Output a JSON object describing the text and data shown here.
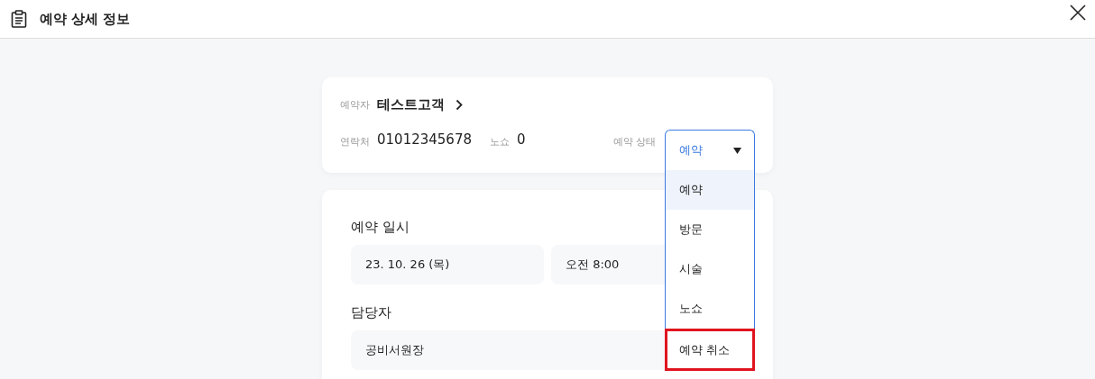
{
  "header": {
    "title": "예약 상세 정보"
  },
  "customer": {
    "label": "예약자",
    "name": "테스트고객",
    "contact_label": "연락처",
    "contact": "01012345678",
    "no_show_label": "노쇼",
    "no_show": "0",
    "status_label": "예약 상태",
    "status": {
      "value": "예약",
      "expanded": true,
      "options": [
        {
          "label": "예약",
          "selected": true,
          "highlighted": false
        },
        {
          "label": "방문",
          "selected": false,
          "highlighted": false
        },
        {
          "label": "시술",
          "selected": false,
          "highlighted": false
        },
        {
          "label": "노쇼",
          "selected": false,
          "highlighted": false
        },
        {
          "label": "예약 취소",
          "selected": false,
          "highlighted": true
        }
      ]
    }
  },
  "reservation": {
    "datetime_label": "예약 일시",
    "date": "23. 10. 26 (목)",
    "time": "오전 8:00",
    "staff_label": "담당자",
    "staff": "공비서원장"
  }
}
